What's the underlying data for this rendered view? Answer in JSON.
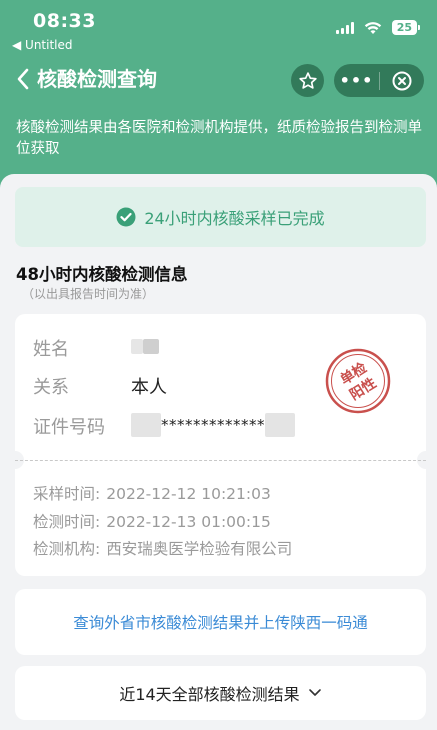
{
  "status_bar": {
    "time": "08:33",
    "back_app": "◀ Untitled",
    "battery": "25"
  },
  "nav": {
    "title": "核酸检测查询",
    "more": "•••"
  },
  "notice": "核酸检测结果由各医院和检测机构提供，纸质检验报告到检测单位获取",
  "banner": {
    "text": "24小时内核酸采样已完成"
  },
  "section": {
    "title": "48小时内核酸检测信息",
    "subtitle": "（以出具报告时间为准）"
  },
  "person": {
    "name_label": "姓名",
    "relation_label": "关系",
    "relation_value": "本人",
    "id_label": "证件号码",
    "id_value": "*************"
  },
  "stamp": {
    "line1": "单检",
    "line2": "阳性"
  },
  "test_info": {
    "sample_label": "采样时间:",
    "sample_value": "2022-12-12 10:21:03",
    "test_label": "检测时间:",
    "test_value": "2022-12-13 01:00:15",
    "org_label": "检测机构:",
    "org_value": "西安瑞奥医学检验有限公司"
  },
  "links": {
    "external": "查询外省市核酸检测结果并上传陕西一码通",
    "all_results": "近14天全部核酸检测结果"
  },
  "colors": {
    "header_green": "#55b08a",
    "banner_text": "#3aa078",
    "stamp_red": "#c9504d",
    "link_blue": "#3b8bd6"
  }
}
